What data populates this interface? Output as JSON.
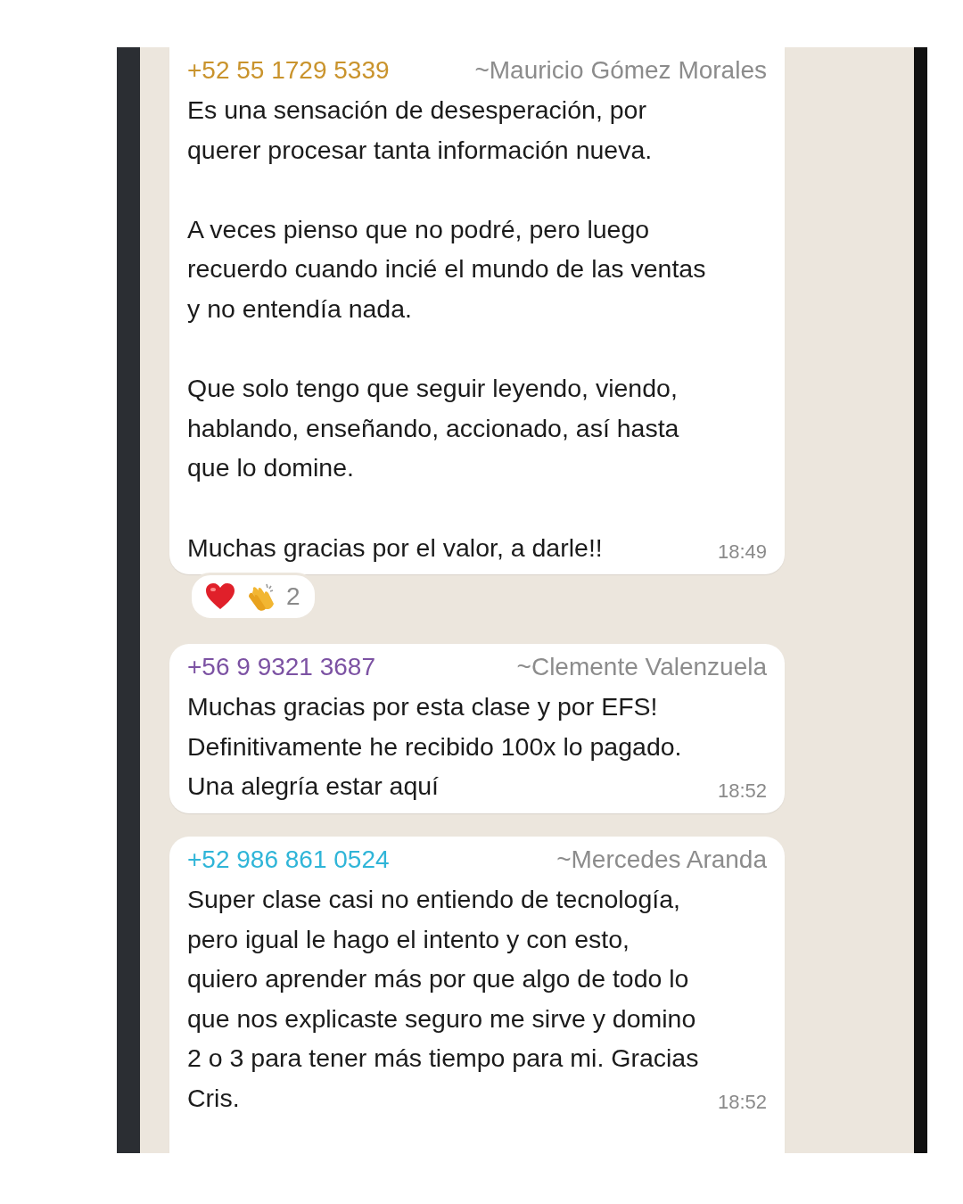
{
  "messages": [
    {
      "phone": "+52 55 1729 5339",
      "sender": "~Mauricio Gómez Morales",
      "color": "#c9932c",
      "text": "Es una sensación de desesperación, por querer procesar tanta información nueva.\n\nA veces pienso que no podré, pero luego recuerdo cuando incié el mundo de las ventas y no entendía nada.\n\nQue solo tengo que seguir leyendo, viendo, hablando, enseñando, accionado, así hasta que lo domine.\n\nMuchas gracias por el valor, a darle!!",
      "time": "18:49",
      "reactions": {
        "emojis": [
          {
            "kind": "heart"
          },
          {
            "kind": "clap"
          }
        ],
        "count": "2"
      }
    },
    {
      "phone": "+56 9 9321 3687",
      "sender": "~Clemente Valenzuela",
      "color": "#7c52a3",
      "text": "Muchas gracias por esta clase y por EFS! Definitivamente he recibido 100x lo pagado. Una alegría estar aquí",
      "time": "18:52"
    },
    {
      "phone": "+52 986 861 0524",
      "sender": "~Mercedes Aranda",
      "color": "#2fb5d8",
      "text": "Super clase casi no entiendo de tecnología, pero igual le hago el intento y con esto, quiero aprender más por que algo de todo lo que nos explicaste seguro me sirve y domino 2 o 3 para tener más tiempo para mi. Gracias Cris.",
      "time": "18:52"
    }
  ]
}
